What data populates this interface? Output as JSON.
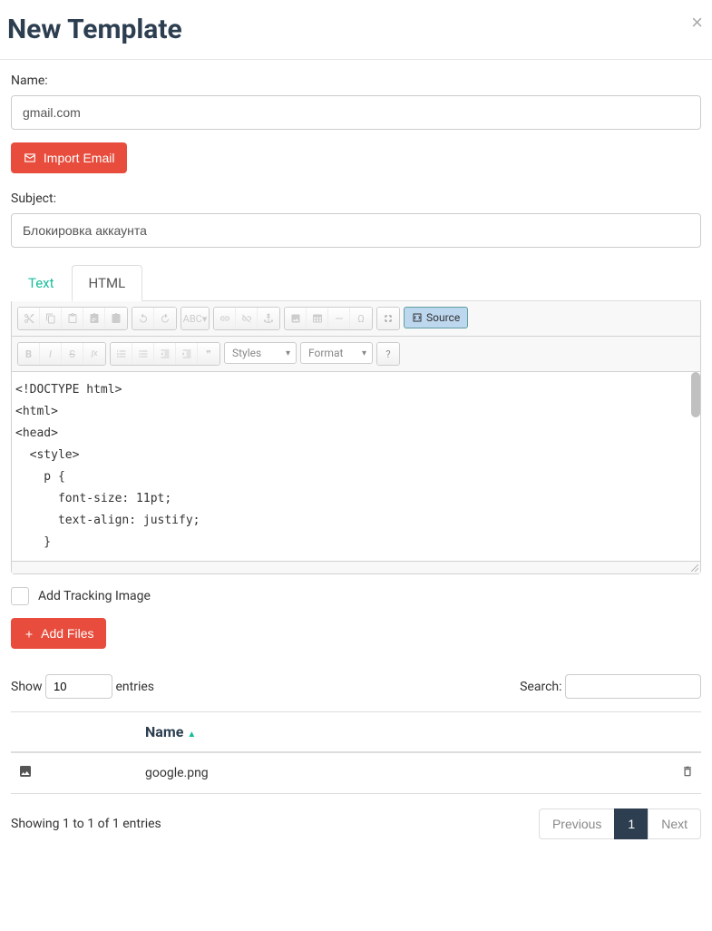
{
  "modal": {
    "title": "New Template",
    "close_label": "×"
  },
  "form": {
    "name_label": "Name:",
    "name_value": "gmail.com",
    "import_email_label": "Import Email",
    "subject_label": "Subject:",
    "subject_value": "Блокировка аккаунта"
  },
  "tabs": {
    "text_label": "Text",
    "html_label": "HTML"
  },
  "toolbar": {
    "styles_label": "Styles",
    "format_label": "Format",
    "source_label": "Source",
    "help_label": "?"
  },
  "editor": {
    "content": "<!DOCTYPE html>\n<html>\n<head>\n  <style>\n    p {\n      font-size: 11pt;\n      text-align: justify;\n    }"
  },
  "tracking": {
    "label": "Add Tracking Image"
  },
  "files": {
    "add_label": "Add Files"
  },
  "table": {
    "show_label": "Show",
    "entries_value": "10",
    "entries_label": "entries",
    "search_label": "Search:",
    "header_name": "Name",
    "rows": [
      {
        "filename": "google.png"
      }
    ],
    "info": "Showing 1 to 1 of 1 entries",
    "prev_label": "Previous",
    "page1_label": "1",
    "next_label": "Next"
  }
}
